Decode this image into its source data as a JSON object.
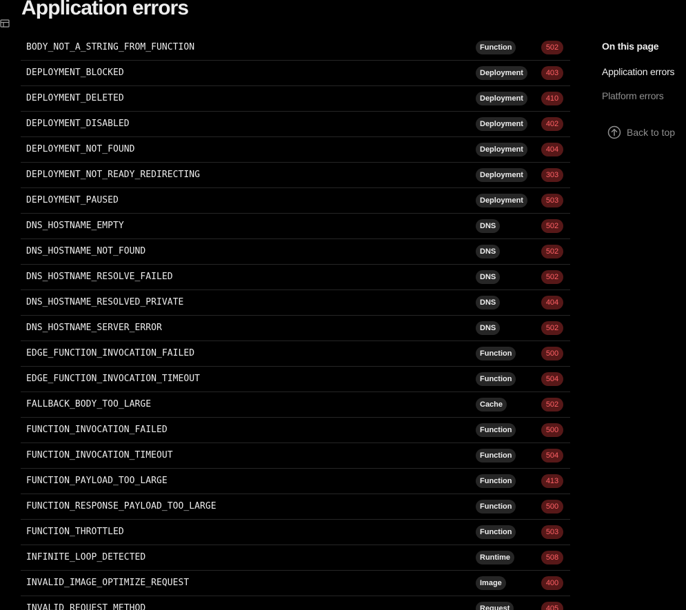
{
  "header": {
    "title": "Application errors"
  },
  "errors": [
    {
      "code": "BODY_NOT_A_STRING_FROM_FUNCTION",
      "category": "Function",
      "status": "502"
    },
    {
      "code": "DEPLOYMENT_BLOCKED",
      "category": "Deployment",
      "status": "403"
    },
    {
      "code": "DEPLOYMENT_DELETED",
      "category": "Deployment",
      "status": "410"
    },
    {
      "code": "DEPLOYMENT_DISABLED",
      "category": "Deployment",
      "status": "402"
    },
    {
      "code": "DEPLOYMENT_NOT_FOUND",
      "category": "Deployment",
      "status": "404"
    },
    {
      "code": "DEPLOYMENT_NOT_READY_REDIRECTING",
      "category": "Deployment",
      "status": "303"
    },
    {
      "code": "DEPLOYMENT_PAUSED",
      "category": "Deployment",
      "status": "503"
    },
    {
      "code": "DNS_HOSTNAME_EMPTY",
      "category": "DNS",
      "status": "502"
    },
    {
      "code": "DNS_HOSTNAME_NOT_FOUND",
      "category": "DNS",
      "status": "502"
    },
    {
      "code": "DNS_HOSTNAME_RESOLVE_FAILED",
      "category": "DNS",
      "status": "502"
    },
    {
      "code": "DNS_HOSTNAME_RESOLVED_PRIVATE",
      "category": "DNS",
      "status": "404"
    },
    {
      "code": "DNS_HOSTNAME_SERVER_ERROR",
      "category": "DNS",
      "status": "502"
    },
    {
      "code": "EDGE_FUNCTION_INVOCATION_FAILED",
      "category": "Function",
      "status": "500"
    },
    {
      "code": "EDGE_FUNCTION_INVOCATION_TIMEOUT",
      "category": "Function",
      "status": "504"
    },
    {
      "code": "FALLBACK_BODY_TOO_LARGE",
      "category": "Cache",
      "status": "502"
    },
    {
      "code": "FUNCTION_INVOCATION_FAILED",
      "category": "Function",
      "status": "500"
    },
    {
      "code": "FUNCTION_INVOCATION_TIMEOUT",
      "category": "Function",
      "status": "504"
    },
    {
      "code": "FUNCTION_PAYLOAD_TOO_LARGE",
      "category": "Function",
      "status": "413"
    },
    {
      "code": "FUNCTION_RESPONSE_PAYLOAD_TOO_LARGE",
      "category": "Function",
      "status": "500"
    },
    {
      "code": "FUNCTION_THROTTLED",
      "category": "Function",
      "status": "503"
    },
    {
      "code": "INFINITE_LOOP_DETECTED",
      "category": "Runtime",
      "status": "508"
    },
    {
      "code": "INVALID_IMAGE_OPTIMIZE_REQUEST",
      "category": "Image",
      "status": "400"
    },
    {
      "code": "INVALID_REQUEST_METHOD",
      "category": "Request",
      "status": "405"
    }
  ],
  "toc": {
    "heading": "On this page",
    "links": [
      {
        "label": "Application errors",
        "active": true
      },
      {
        "label": "Platform errors",
        "active": false
      }
    ],
    "back_to_top": "Back to top"
  },
  "icons": {
    "sidebar_toggle": "sidebar-toggle-icon",
    "back_to_top": "arrow-up-circle-icon"
  },
  "colors": {
    "background": "#000000",
    "text": "#ededed",
    "muted": "#8f8f8f",
    "category_badge_bg": "#262626",
    "status_badge_bg": "#571818",
    "status_badge_text": "#ff6166"
  }
}
